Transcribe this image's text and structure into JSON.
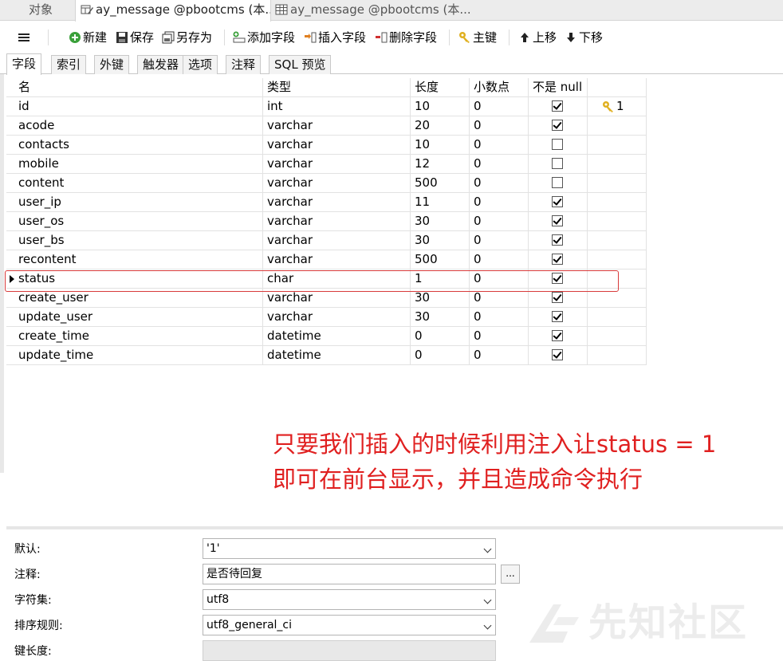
{
  "window_tabs": [
    {
      "label": "对象",
      "icon": "none"
    },
    {
      "label": "ay_message @pbootcms (本...",
      "icon": "pencil-table-icon"
    },
    {
      "label": "ay_message @pbootcms (本...",
      "icon": "table-icon"
    }
  ],
  "toolbar": {
    "new": "新建",
    "save": "保存",
    "save_as": "另存为",
    "add_field": "添加字段",
    "insert_field": "插入字段",
    "delete_field": "删除字段",
    "primary_key": "主键",
    "move_up": "上移",
    "move_down": "下移"
  },
  "sub_tabs": [
    "字段",
    "索引",
    "外键",
    "触发器",
    "选项",
    "注释",
    "SQL 预览"
  ],
  "columns": [
    "名",
    "类型",
    "长度",
    "小数点",
    "不是 null",
    ""
  ],
  "rows": [
    {
      "name": "id",
      "type": "int",
      "length": "10",
      "decimals": "0",
      "not_null": true,
      "key": "1"
    },
    {
      "name": "acode",
      "type": "varchar",
      "length": "20",
      "decimals": "0",
      "not_null": true,
      "key": ""
    },
    {
      "name": "contacts",
      "type": "varchar",
      "length": "10",
      "decimals": "0",
      "not_null": false,
      "key": ""
    },
    {
      "name": "mobile",
      "type": "varchar",
      "length": "12",
      "decimals": "0",
      "not_null": false,
      "key": ""
    },
    {
      "name": "content",
      "type": "varchar",
      "length": "500",
      "decimals": "0",
      "not_null": false,
      "key": ""
    },
    {
      "name": "user_ip",
      "type": "varchar",
      "length": "11",
      "decimals": "0",
      "not_null": true,
      "key": ""
    },
    {
      "name": "user_os",
      "type": "varchar",
      "length": "30",
      "decimals": "0",
      "not_null": true,
      "key": ""
    },
    {
      "name": "user_bs",
      "type": "varchar",
      "length": "30",
      "decimals": "0",
      "not_null": true,
      "key": ""
    },
    {
      "name": "recontent",
      "type": "varchar",
      "length": "500",
      "decimals": "0",
      "not_null": true,
      "key": ""
    },
    {
      "name": "status",
      "type": "char",
      "length": "1",
      "decimals": "0",
      "not_null": true,
      "key": "",
      "current": true
    },
    {
      "name": "create_user",
      "type": "varchar",
      "length": "30",
      "decimals": "0",
      "not_null": true,
      "key": ""
    },
    {
      "name": "update_user",
      "type": "varchar",
      "length": "30",
      "decimals": "0",
      "not_null": true,
      "key": ""
    },
    {
      "name": "create_time",
      "type": "datetime",
      "length": "0",
      "decimals": "0",
      "not_null": true,
      "key": ""
    },
    {
      "name": "update_time",
      "type": "datetime",
      "length": "0",
      "decimals": "0",
      "not_null": true,
      "key": ""
    }
  ],
  "annotation": {
    "line1": "只要我们插入的时候利用注入让status = 1",
    "line2": "即可在前台显示，并且造成命令执行",
    "color": "#e02020"
  },
  "properties": {
    "default_label": "默认:",
    "default_value": "'1'",
    "comment_label": "注释:",
    "comment_value": "是否待回复",
    "comment_button": "...",
    "charset_label": "字符集:",
    "charset_value": "utf8",
    "collation_label": "排序规则:",
    "collation_value": "utf8_general_ci",
    "key_length_label": "键长度:",
    "key_length_value": ""
  },
  "watermark": "先知社区"
}
